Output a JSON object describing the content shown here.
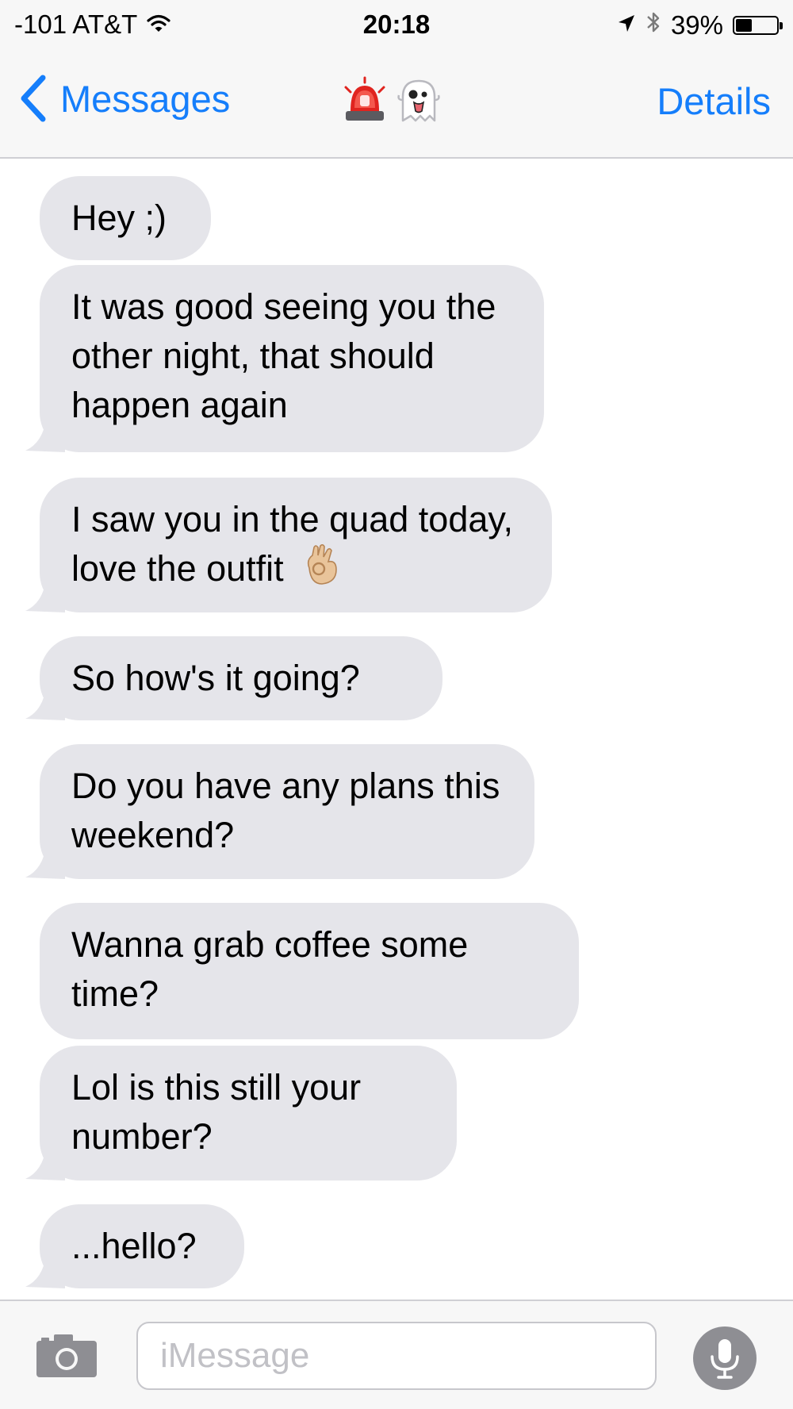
{
  "status_bar": {
    "carrier": "-101 AT&T",
    "time": "20:18",
    "battery": "39%",
    "battery_level": 0.39,
    "icons": [
      "wifi-icon",
      "location-arrow-icon",
      "bluetooth-icon",
      "battery-icon"
    ]
  },
  "nav": {
    "back_label": "Messages",
    "details_label": "Details",
    "title_emojis": [
      "police-light-emoji",
      "ghost-emoji"
    ]
  },
  "messages": [
    {
      "text": "Hey ;)"
    },
    {
      "text": "It was good seeing you the other night, that should happen again"
    },
    {
      "text": "I saw you in the quad today, love the outfit",
      "emoji": "ok-hand-emoji"
    },
    {
      "text": "So how's it going?"
    },
    {
      "text": "Do you have any plans this weekend?"
    },
    {
      "text": "Wanna grab coffee some time?"
    },
    {
      "text": "Lol is this still your number?"
    },
    {
      "text": "...hello?"
    }
  ],
  "composer": {
    "placeholder": "iMessage",
    "value": ""
  },
  "colors": {
    "accent": "#157efb",
    "incoming_bubble": "#e5e5ea",
    "bar_background": "#f7f7f7",
    "mic_background": "#8e8e93"
  }
}
